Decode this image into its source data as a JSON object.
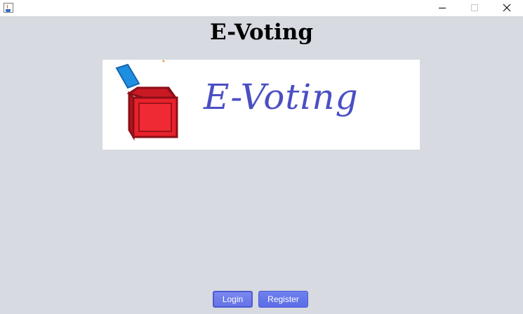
{
  "window": {
    "controls": {
      "minimize": "minimize-icon",
      "maximize": "maximize-icon",
      "close": "close-icon"
    }
  },
  "main": {
    "title": "E-Voting",
    "banner_text": "E-Voting"
  },
  "buttons": {
    "login": "Login",
    "register": "Register"
  },
  "colors": {
    "background": "#d7dae0",
    "banner_text": "#4b4fc4",
    "button": "#6574e6",
    "ballot_box": "#e0202a",
    "ballot_paper": "#1e8fe0"
  }
}
